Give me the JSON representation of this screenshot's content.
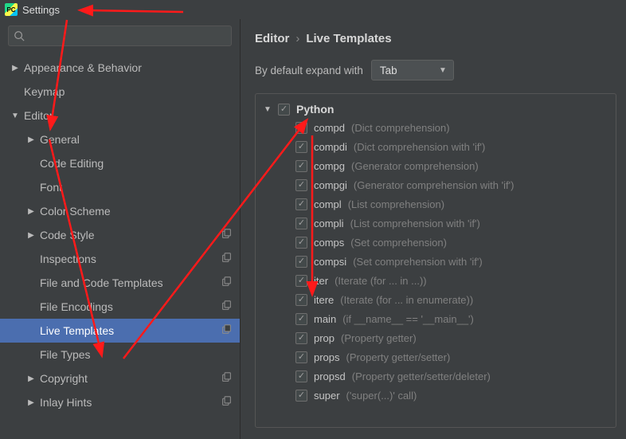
{
  "title": "Settings",
  "sidebar": {
    "items": [
      {
        "label": "Appearance & Behavior",
        "level": 0,
        "arrow": "right",
        "copy": false
      },
      {
        "label": "Keymap",
        "level": 0,
        "arrow": "none",
        "copy": false
      },
      {
        "label": "Editor",
        "level": 0,
        "arrow": "down",
        "copy": false
      },
      {
        "label": "General",
        "level": 1,
        "arrow": "right",
        "copy": false
      },
      {
        "label": "Code Editing",
        "level": 1,
        "arrow": "none",
        "copy": false
      },
      {
        "label": "Font",
        "level": 1,
        "arrow": "none",
        "copy": false
      },
      {
        "label": "Color Scheme",
        "level": 1,
        "arrow": "right",
        "copy": false
      },
      {
        "label": "Code Style",
        "level": 1,
        "arrow": "right",
        "copy": true
      },
      {
        "label": "Inspections",
        "level": 1,
        "arrow": "none",
        "copy": true
      },
      {
        "label": "File and Code Templates",
        "level": 1,
        "arrow": "none",
        "copy": true
      },
      {
        "label": "File Encodings",
        "level": 1,
        "arrow": "none",
        "copy": true
      },
      {
        "label": "Live Templates",
        "level": 1,
        "arrow": "none",
        "copy": true,
        "selected": true
      },
      {
        "label": "File Types",
        "level": 1,
        "arrow": "none",
        "copy": false
      },
      {
        "label": "Copyright",
        "level": 1,
        "arrow": "right",
        "copy": true
      },
      {
        "label": "Inlay Hints",
        "level": 1,
        "arrow": "right",
        "copy": true
      }
    ]
  },
  "breadcrumb": {
    "l0": "Editor",
    "l1": "Live Templates"
  },
  "expand": {
    "label": "By default expand with",
    "value": "Tab"
  },
  "group": {
    "name": "Python",
    "checked": true,
    "items": [
      {
        "key": "compd",
        "desc": "(Dict comprehension)"
      },
      {
        "key": "compdi",
        "desc": "(Dict comprehension with 'if')"
      },
      {
        "key": "compg",
        "desc": "(Generator comprehension)"
      },
      {
        "key": "compgi",
        "desc": "(Generator comprehension with 'if')"
      },
      {
        "key": "compl",
        "desc": "(List comprehension)"
      },
      {
        "key": "compli",
        "desc": "(List comprehension with 'if')"
      },
      {
        "key": "comps",
        "desc": "(Set comprehension)"
      },
      {
        "key": "compsi",
        "desc": "(Set comprehension with 'if')"
      },
      {
        "key": "iter",
        "desc": "(Iterate (for ... in ...))"
      },
      {
        "key": "itere",
        "desc": "(Iterate (for ... in enumerate))"
      },
      {
        "key": "main",
        "desc": "(if __name__ == '__main__')"
      },
      {
        "key": "prop",
        "desc": "(Property getter)"
      },
      {
        "key": "props",
        "desc": "(Property getter/setter)"
      },
      {
        "key": "propsd",
        "desc": "(Property getter/setter/deleter)"
      },
      {
        "key": "super",
        "desc": "('super(...)' call)"
      }
    ]
  }
}
